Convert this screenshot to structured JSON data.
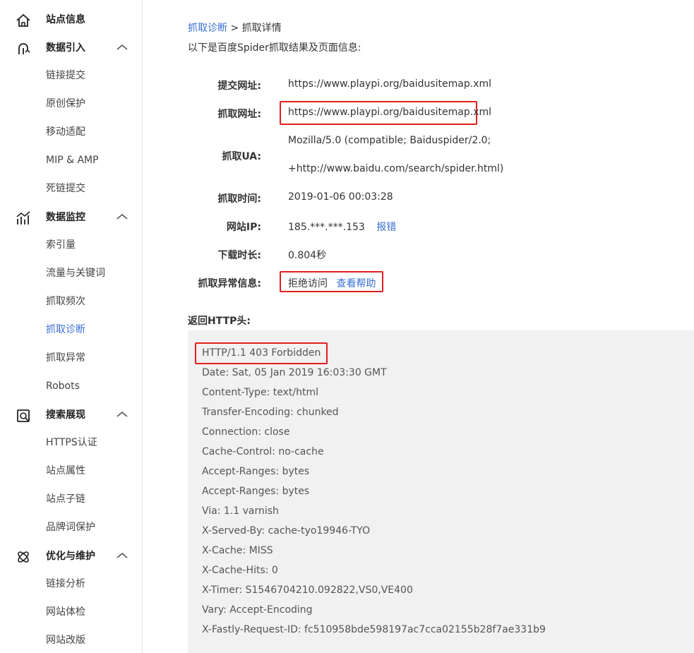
{
  "sidebar": {
    "sections": [
      {
        "label": "站点信息",
        "icon": "home-icon",
        "collapsible": false
      },
      {
        "label": "数据引入",
        "icon": "data-import-icon",
        "collapsible": true,
        "items": [
          "链接提交",
          "原创保护",
          "移动适配",
          "MIP & AMP",
          "死链提交"
        ]
      },
      {
        "label": "数据监控",
        "icon": "chart-monitor-icon",
        "collapsible": true,
        "items": [
          "索引量",
          "流量与关键词",
          "抓取频次",
          "抓取诊断",
          "抓取异常",
          "Robots"
        ]
      },
      {
        "label": "搜索展现",
        "icon": "search-display-icon",
        "collapsible": true,
        "items": [
          "HTTPS认证",
          "站点属性",
          "站点子链",
          "品牌词保护"
        ]
      },
      {
        "label": "优化与维护",
        "icon": "atom-optimize-icon",
        "collapsible": true,
        "items": [
          "链接分析",
          "网站体检",
          "网站改版"
        ]
      }
    ],
    "active_item": "抓取诊断"
  },
  "breadcrumb": {
    "link": "抓取诊断",
    "separator": ">",
    "current": "抓取详情"
  },
  "intro": "以下是百度Spider抓取结果及页面信息:",
  "details": {
    "submit_url_label": "提交网址:",
    "submit_url": "https://www.playpi.org/baidusitemap.xml",
    "crawl_url_label": "抓取网址:",
    "crawl_url": "https://www.playpi.org/baidusitemap.xml",
    "ua_label": "抓取UA:",
    "ua_line1": "Mozilla/5.0 (compatible; Baiduspider/2.0;",
    "ua_line2": "+http://www.baidu.com/search/spider.html)",
    "time_label": "抓取时间:",
    "time": "2019-01-06 00:03:28",
    "ip_label": "网站IP:",
    "ip": "185.***.***.153",
    "ip_report": "报错",
    "download_label": "下载时长:",
    "download": "0.804秒",
    "error_label": "抓取异常信息:",
    "error": "拒绝访问",
    "error_help": "查看帮助"
  },
  "http_header": {
    "title": "返回HTTP头:",
    "lines": [
      "HTTP/1.1 403 Forbidden",
      "Date: Sat, 05 Jan 2019 16:03:30 GMT",
      "Content-Type: text/html",
      "Transfer-Encoding: chunked",
      "Connection: close",
      "Cache-Control: no-cache",
      "Accept-Ranges: bytes",
      "Accept-Ranges: bytes",
      "Via: 1.1 varnish",
      "X-Served-By: cache-tyo19946-TYO",
      "X-Cache: MISS",
      "X-Cache-Hits: 0",
      "X-Timer: S1546704210.092822,VS0,VE400",
      "Vary: Accept-Encoding",
      "X-Fastly-Request-ID: fc510958bde598197ac7cca02155b28f7ae331b9"
    ]
  },
  "colors": {
    "accent": "#3b6fd6",
    "highlight": "#e0201d",
    "header_bg": "#f1f1f1"
  }
}
